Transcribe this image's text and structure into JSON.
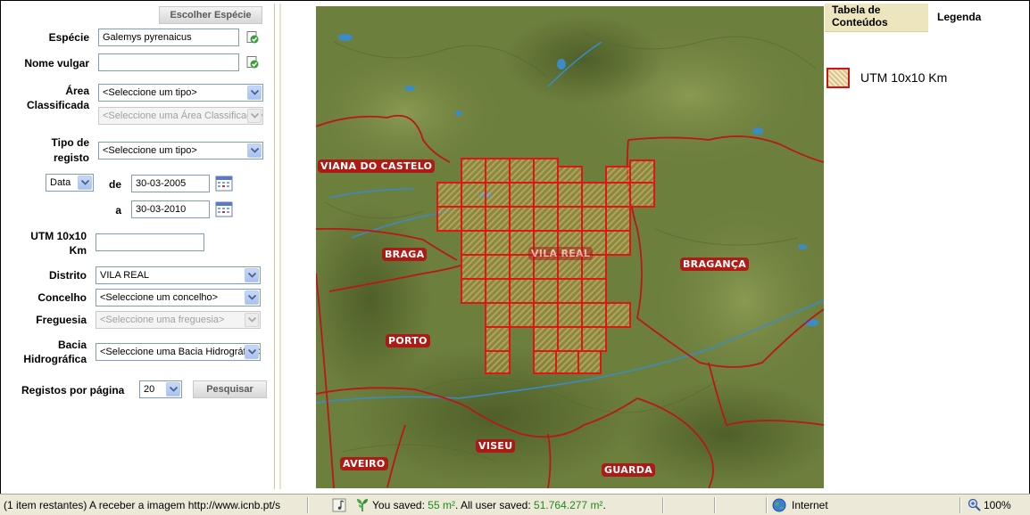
{
  "form": {
    "choose_species_button": "Escolher Espécie",
    "species_label": "Espécie",
    "species_value": "Galemys pyrenaicus",
    "common_name_label": "Nome vulgar",
    "common_name_value": "",
    "area_label_1": "Área",
    "area_label_2": "Classificada",
    "area_type_select": "<Seleccione um tipo>",
    "area_select": "<Seleccione uma Área Classificada>",
    "record_type_label_1": "Tipo de",
    "record_type_label_2": "registo",
    "record_type_select": "<Seleccione um tipo>",
    "date_select": "Data",
    "from_label": "de",
    "from_value": "30-03-2005",
    "to_label": "a",
    "to_value": "30-03-2010",
    "utm_label_1": "UTM 10x10",
    "utm_label_2": "Km",
    "utm_value": "",
    "district_label": "Distrito",
    "district_select": "VILA REAL",
    "council_label": "Concelho",
    "council_select": "<Seleccione um concelho>",
    "parish_label": "Freguesia",
    "parish_select": "<Seleccione uma freguesia>",
    "basin_label_1": "Bacia",
    "basin_label_2": "Hidrográfica",
    "basin_select": "<Seleccione uma Bacia Hidrográfica>",
    "per_page_label": "Registos por página",
    "per_page_select": "20",
    "search_button": "Pesquisar"
  },
  "map": {
    "cities": [
      "VIANA DO CASTELO",
      "BRAGA",
      "VILA REAL",
      "BRAGANÇA",
      "PORTO",
      "VISEU",
      "AVEIRO",
      "GUARDA"
    ],
    "grid_color": "#e01616",
    "border_color": "#b81818",
    "terrain_color": "#6b7d3b",
    "water_color": "#3a8cc8"
  },
  "side": {
    "tab_toc": "Tabela de Conteúdos",
    "tab_legend": "Legenda",
    "legend_item": "UTM 10x10 Km"
  },
  "status": {
    "loading_text": "(1 item restantes) A receber a imagem http://www.icnb.pt/s",
    "saved_prefix": "You saved:",
    "saved_value": "55 m²",
    "all_prefix": ". All user saved:",
    "all_value": "51.764.277 m²",
    "all_suffix": ".",
    "zone": "Internet",
    "zoom": "100%"
  }
}
